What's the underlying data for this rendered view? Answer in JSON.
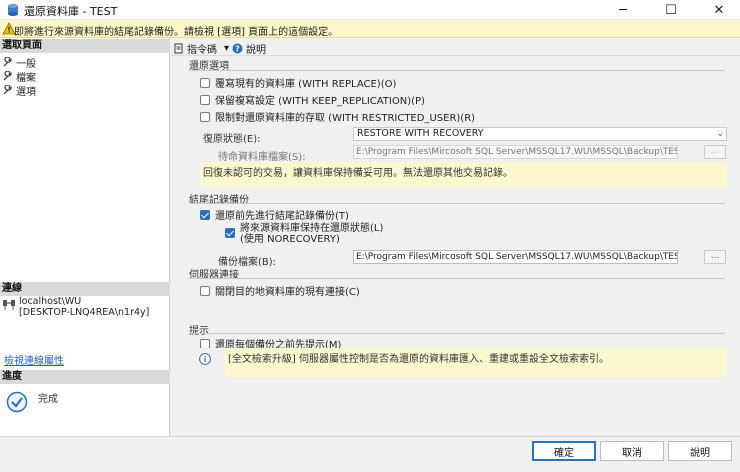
{
  "window": {
    "title": "還原資料庫 - TEST",
    "minimize_glyph": "─",
    "maximize_glyph": "☐",
    "close_glyph": "✕"
  },
  "warning": {
    "text": "即將進行來源資料庫的結尾記錄備份。請檢視 [選項] 頁面上的這個設定。",
    "icon": "warning-icon"
  },
  "left": {
    "select_page_header": "選取頁面",
    "pages": [
      {
        "label": "一般",
        "icon": "wrench-icon"
      },
      {
        "label": "檔案",
        "icon": "wrench-icon"
      },
      {
        "label": "選項",
        "icon": "wrench-icon"
      }
    ],
    "connection_header": "連線",
    "connection_line1": "localhost\\WU",
    "connection_line2": "[DESKTOP-LNQ4REA\\n1r4y]",
    "view_connection_link": "檢視連線屬性",
    "progress_header": "進度",
    "progress_status": "完成"
  },
  "toolbar": {
    "script_label": "指令碼",
    "dropdown_glyph": "▾",
    "help_label": "說明"
  },
  "restore_options": {
    "group_label": "還原選項",
    "overwrite": {
      "label": "覆寫現有的資料庫 (WITH REPLACE)(O)",
      "checked": false
    },
    "keep_replication": {
      "label": "保留複寫設定 (WITH KEEP_REPLICATION)(P)",
      "checked": false
    },
    "restricted_user": {
      "label": "限制對還原資料庫的存取 (WITH RESTRICTED_USER)(R)",
      "checked": false
    },
    "recovery_state_label": "復原狀態(E):",
    "recovery_state_value": "RESTORE WITH RECOVERY",
    "standby_file_label": "待命資料庫檔案(S):",
    "standby_file_value": "E:\\Program Files\\Mircosoft  SQL Server\\MSSQL17.WU\\MSSQL\\Backup\\TEST_Rollb",
    "browse_glyph": "...",
    "recovery_hint": "回復未認可的交易，讓資料庫保持備妥可用。無法還原其他交易記錄。"
  },
  "tail_log": {
    "group_label": "結尾記錄備份",
    "take_tail_log": {
      "label": "還原前先進行結尾記錄備份(T)",
      "checked": true
    },
    "leave_restoring": {
      "label_line1": "將來源資料庫保持在還原狀態(L)",
      "label_line2": "(使用 NORECOVERY)",
      "checked": true
    },
    "backup_file_label": "備份檔案(B):",
    "backup_file_value": "E:\\Program Files\\Mircosoft  SQL Server\\MSSQL17.WU\\MSSQL\\Backup\\TEST_LogB",
    "browse_glyph": "..."
  },
  "server_connections": {
    "group_label": "伺服器連接",
    "close_existing": {
      "label": "關閉目的地資料庫的現有連接(C)",
      "checked": false
    }
  },
  "prompt": {
    "group_label": "提示",
    "prompt_before_each": {
      "label": "還原每個備份之前先提示(M)",
      "checked": false
    },
    "fulltext_info": "[全文檢索升級] 伺服器屬性控制是否為還原的資料庫匯入、重建或重設全文檢索索引。"
  },
  "buttons": {
    "ok": "確定",
    "cancel": "取消",
    "help": "說明"
  },
  "colors": {
    "accent": "#2c6fbd",
    "warning_bg": "#fdf6c9",
    "hint_bg": "#fdf7cf",
    "link": "#2b5fb8"
  }
}
